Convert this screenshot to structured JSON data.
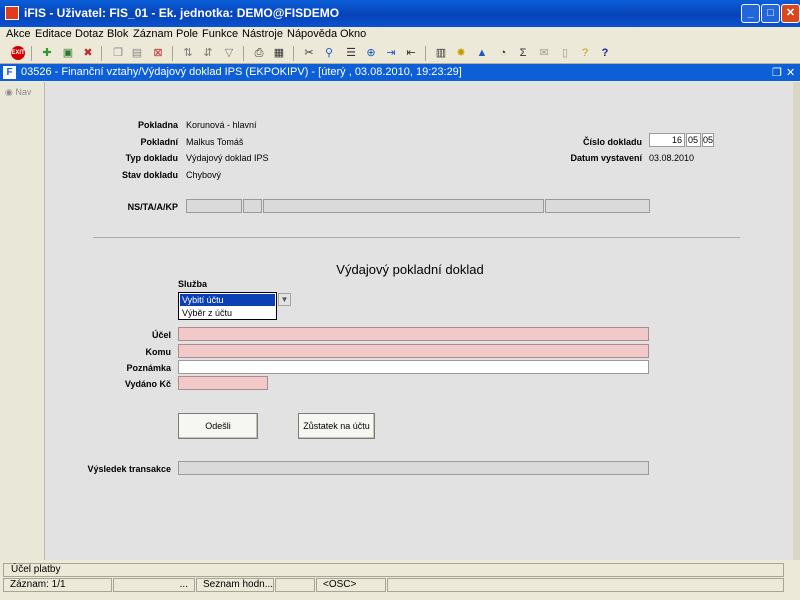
{
  "window": {
    "title": "iFIS - Uživatel: FIS_01 - Ek. jednotka: DEMO@FISDEMO"
  },
  "menu": [
    "Akce",
    "Editace",
    "Dotaz",
    "Blok",
    "Záznam",
    "Pole",
    "Funkce",
    "Nástroje",
    "Nápověda",
    "Okno"
  ],
  "toolbar": {
    "exit_label": "EXIT"
  },
  "form": {
    "title": "03526 - Finanční vztahy/Výdajový doklad IPS (EKPOKIPV) - [úterý  , 03.08.2010, 19:23:29]"
  },
  "sidebar": {
    "nav": "Nav"
  },
  "header": {
    "pokladna_label": "Pokladna",
    "pokladna_value": "Korunová - hlavní",
    "pokladni_label": "Pokladní",
    "pokladni_value": "Malkus Tomáš",
    "typ_label": "Typ dokladu",
    "typ_value": "Výdajový doklad IPS",
    "stav_label": "Stav dokladu",
    "stav_value": "Chybový",
    "cislo_label": "Číslo dokladu",
    "cislo_1": "16",
    "cislo_2": "05",
    "cislo_3": "05",
    "datum_label": "Datum vystavení",
    "datum_value": "03.08.2010",
    "ns_label": "NS/TA/A/KP"
  },
  "doklad": {
    "title": "Výdajový pokladní doklad",
    "sluzba_label": "Služba",
    "sluzba_options": [
      "Vybití účtu",
      "Výběr z účtu"
    ],
    "ucel_label": "Účel",
    "komu_label": "Komu",
    "poznamka_label": "Poznámka",
    "vydano_label": "Vydáno Kč",
    "odesli_button": "Odešli",
    "zustatek_button": "Zůstatek na účtu",
    "vysledek_label": "Výsledek transakce"
  },
  "status": {
    "hint": "Účel platby",
    "zaznam": "Záznam: 1/1",
    "dots": "...",
    "seznam": "Seznam hodn...",
    "osc": "<OSC>"
  }
}
